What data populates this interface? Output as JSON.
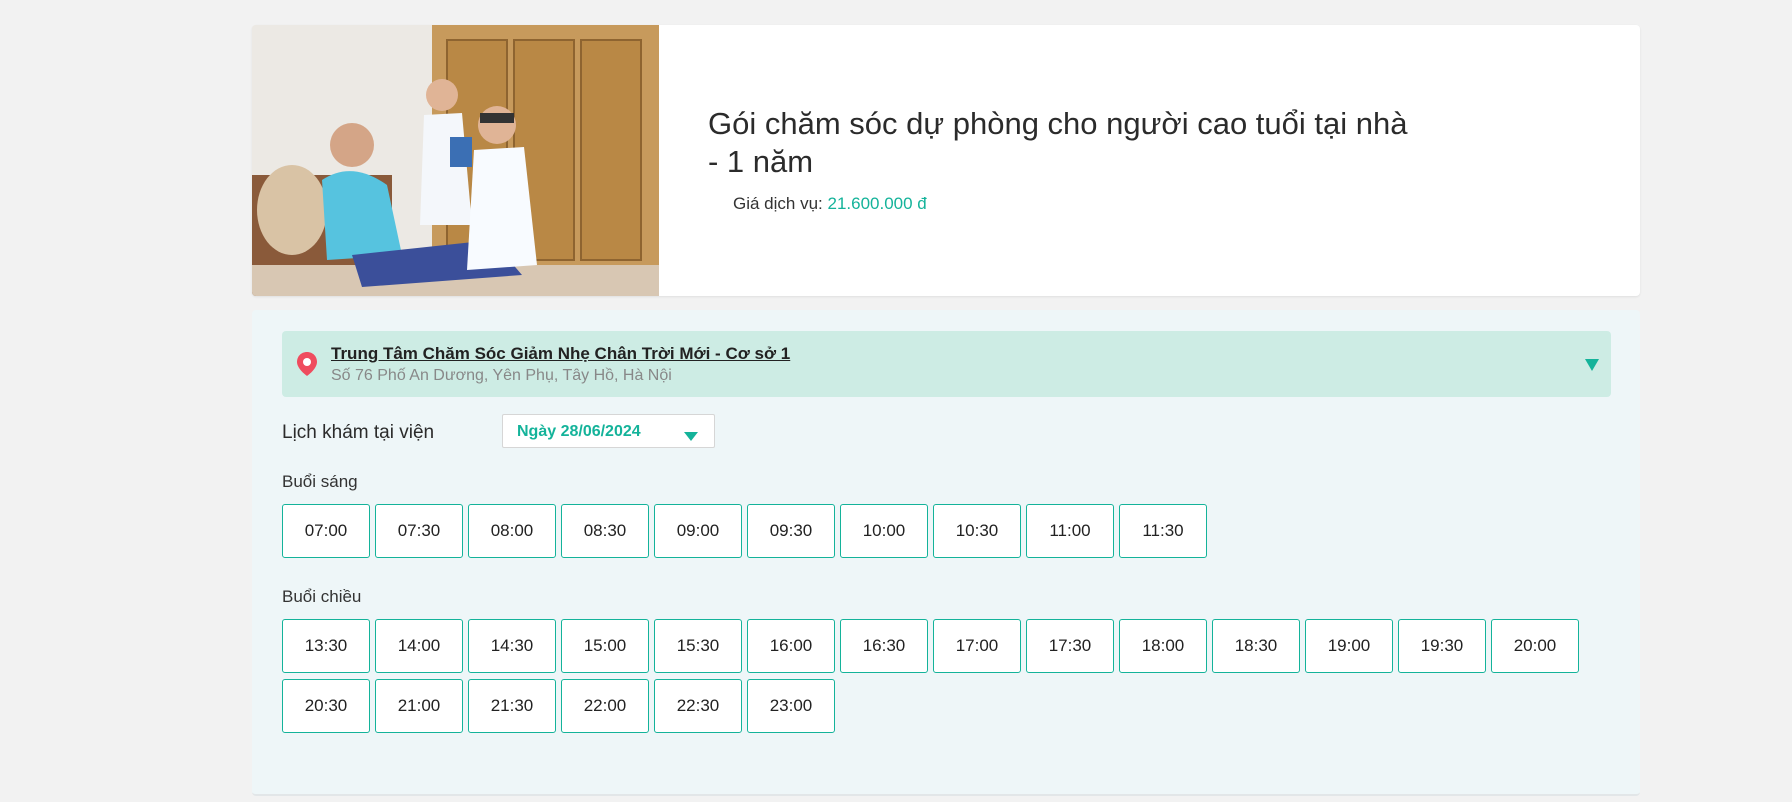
{
  "service": {
    "title": "Gói chăm sóc dự phòng cho người cao tuổi tại nhà - 1 năm",
    "price_label": "Giá dịch vụ:",
    "price_value": "21.600.000 đ"
  },
  "location": {
    "name": "Trung Tâm Chăm Sóc Giảm Nhẹ Chân Trời Mới - Cơ sở 1",
    "address": "Số 76 Phố An Dương, Yên Phụ, Tây Hồ, Hà Nội"
  },
  "schedule": {
    "label": "Lịch khám tại viện",
    "date": "Ngày 28/06/2024"
  },
  "morning": {
    "label": "Buổi sáng",
    "slots": [
      "07:00",
      "07:30",
      "08:00",
      "08:30",
      "09:00",
      "09:30",
      "10:00",
      "10:30",
      "11:00",
      "11:30"
    ]
  },
  "afternoon": {
    "label": "Buổi chiều",
    "slots": [
      "13:30",
      "14:00",
      "14:30",
      "15:00",
      "15:30",
      "16:00",
      "16:30",
      "17:00",
      "17:30",
      "18:00",
      "18:30",
      "19:00",
      "19:30",
      "20:00",
      "20:30",
      "21:00",
      "21:30",
      "22:00",
      "22:30",
      "23:00"
    ]
  },
  "colors": {
    "accent": "#14b39a",
    "location_bg": "#cdece4",
    "pin": "#ef4c5e"
  }
}
